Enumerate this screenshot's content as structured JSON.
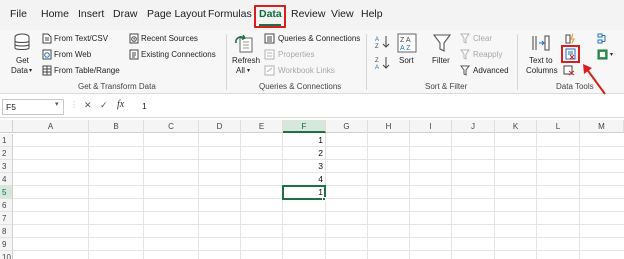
{
  "menu": {
    "file": "File",
    "home": "Home",
    "insert": "Insert",
    "draw": "Draw",
    "page_layout": "Page Layout",
    "formulas": "Formulas",
    "data": "Data",
    "review": "Review",
    "view": "View",
    "help": "Help",
    "active_tab": "Data",
    "accent_color": "#1e7145",
    "highlight_color": "#d62020"
  },
  "ribbon": {
    "get_transform": {
      "get_data_line1": "Get",
      "get_data_line2": "Data",
      "from_text_csv": "From Text/CSV",
      "from_web": "From Web",
      "from_table_range": "From Table/Range",
      "recent_sources": "Recent Sources",
      "existing_connections": "Existing Connections",
      "group_label": "Get & Transform Data"
    },
    "queries": {
      "refresh_line1": "Refresh",
      "refresh_line2": "All",
      "queries_connections": "Queries & Connections",
      "properties": "Properties",
      "workbook_links": "Workbook Links",
      "group_label": "Queries & Connections"
    },
    "sort_filter": {
      "sort": "Sort",
      "filter": "Filter",
      "clear": "Clear",
      "reapply": "Reapply",
      "advanced": "Advanced",
      "group_label": "Sort & Filter"
    },
    "data_tools": {
      "text_to_line1": "Text to",
      "text_to_line2": "Columns",
      "group_label": "Data Tools"
    }
  },
  "formula_bar": {
    "name_box": "F5",
    "cancel_symbol": "✕",
    "enter_symbol": "✓",
    "fx": "fx",
    "value": "1"
  },
  "grid": {
    "columns": [
      "A",
      "B",
      "C",
      "D",
      "E",
      "F",
      "G",
      "H",
      "I",
      "J",
      "K",
      "L",
      "M"
    ],
    "rows": [
      "1",
      "2",
      "3",
      "4",
      "5",
      "6",
      "7",
      "8",
      "9",
      "10"
    ],
    "active_cell": "F5",
    "cells": [
      {
        "ref": "F1",
        "value": "1"
      },
      {
        "ref": "F2",
        "value": "2"
      },
      {
        "ref": "F3",
        "value": "3"
      },
      {
        "ref": "F4",
        "value": "4"
      },
      {
        "ref": "F5",
        "value": "1"
      }
    ]
  }
}
